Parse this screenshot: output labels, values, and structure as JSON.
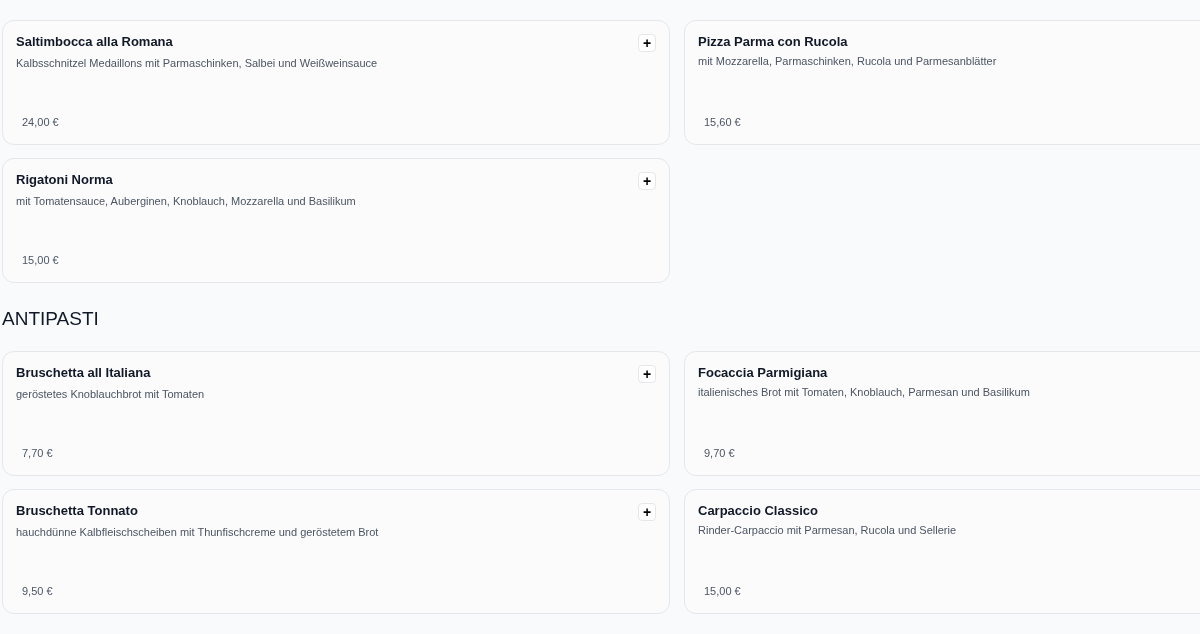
{
  "sections": [
    {
      "items": [
        {
          "name": "Saltimbocca alla Romana",
          "description": "Kalbsschnitzel Medaillons mit Parmaschinken, Salbei und Weißweinsauce",
          "price": "24,00 €",
          "add_button": "+"
        },
        {
          "name": "Pizza Parma con Rucola",
          "description": "mit Mozzarella, Parmaschinken, Rucola und Parmesanblätter",
          "price": "15,60 €"
        },
        {
          "name": "Rigatoni Norma",
          "description": "mit Tomatensauce, Auberginen, Knoblauch, Mozzarella und Basilikum",
          "price": "15,00 €",
          "add_button": "+"
        }
      ]
    },
    {
      "title": "ANTIPASTI",
      "items": [
        {
          "name": "Bruschetta all Italiana",
          "description": "geröstetes Knoblauchbrot mit Tomaten",
          "price": "7,70 €",
          "add_button": "+"
        },
        {
          "name": "Focaccia Parmigiana",
          "description": "italienisches Brot mit Tomaten, Knoblauch, Parmesan und Basilikum",
          "price": "9,70 €"
        },
        {
          "name": "Bruschetta Tonnato",
          "description": "hauchdünne Kalbfleischscheiben mit Thunfischcreme und geröstetem Brot",
          "price": "9,50 €",
          "add_button": "+"
        },
        {
          "name": "Carpaccio Classico",
          "description": "Rinder-Carpaccio mit Parmesan, Rucola und Sellerie",
          "price": "15,00 €"
        }
      ]
    }
  ]
}
